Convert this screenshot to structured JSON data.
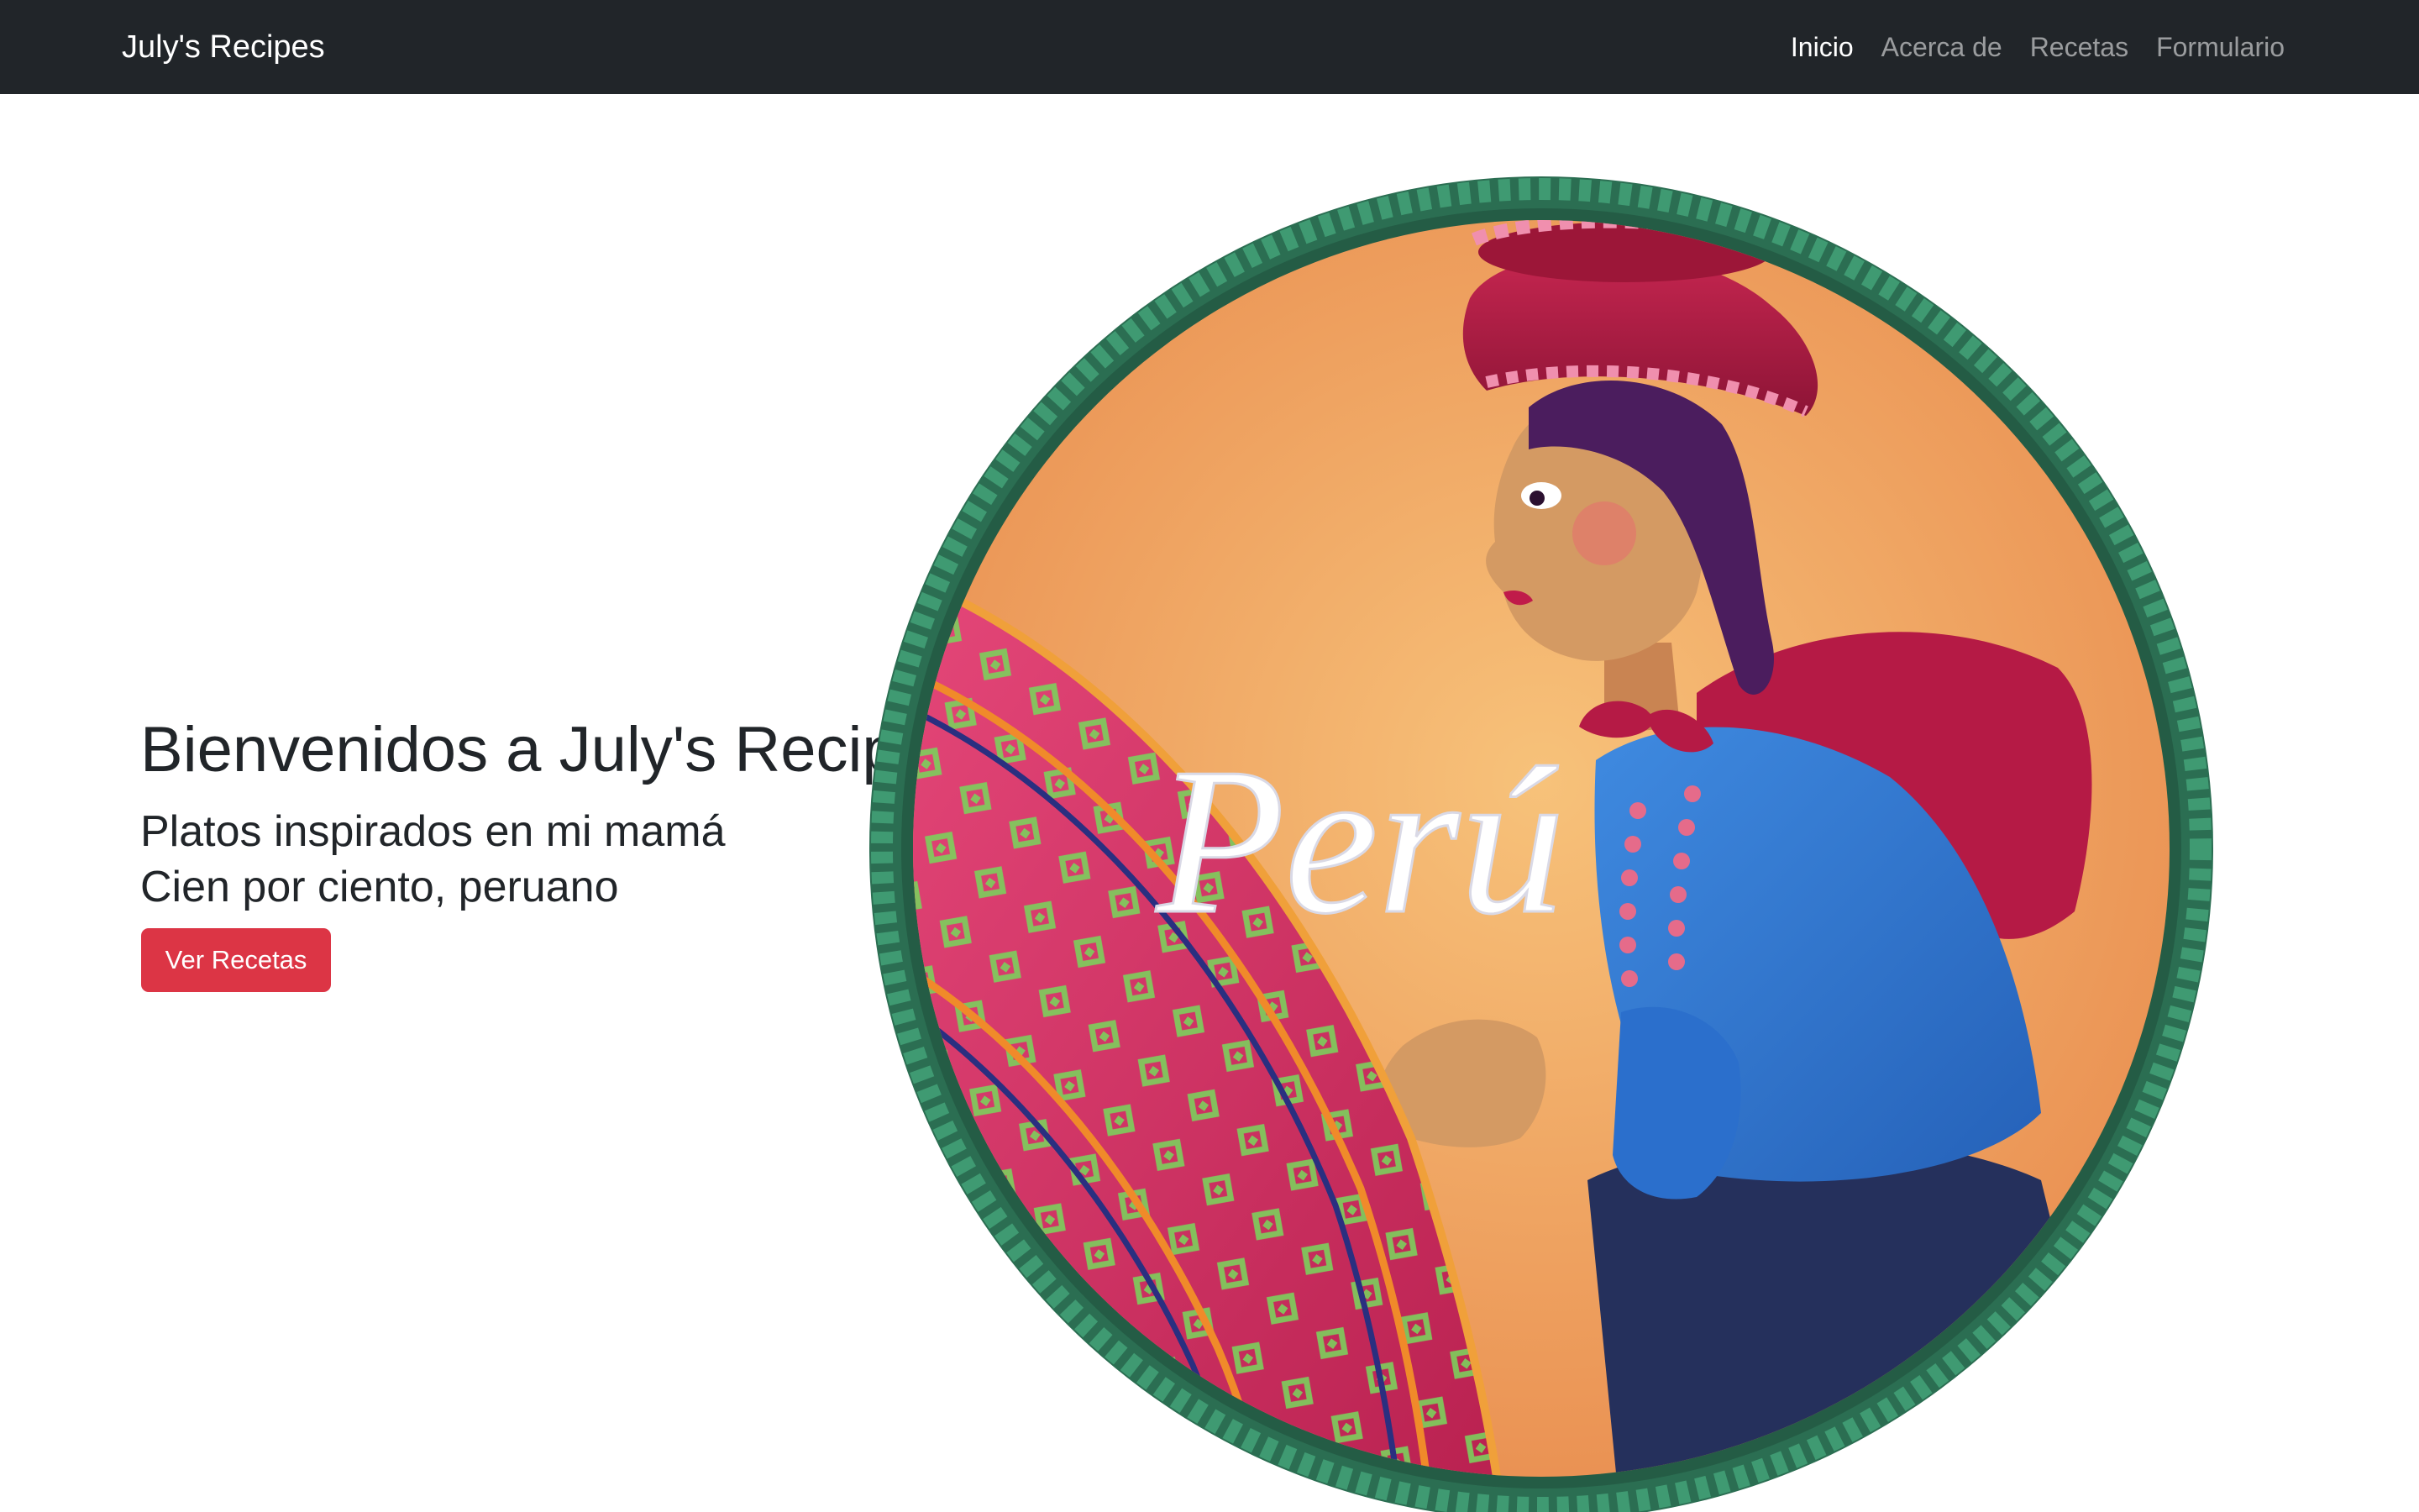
{
  "navbar": {
    "brand": "July's Recipes",
    "links": [
      {
        "label": "Inicio",
        "active": true
      },
      {
        "label": "Acerca de",
        "active": false
      },
      {
        "label": "Recetas",
        "active": false
      },
      {
        "label": "Formulario",
        "active": false
      }
    ]
  },
  "hero": {
    "title": "Bienvenidos a July's Recipes",
    "subtitle_line1": "Platos inspirados en mi mamá",
    "subtitle_line2": "Cien por ciento, peruano",
    "button_label": "Ver Recetas"
  },
  "illustration": {
    "script_text": "Perú"
  },
  "colors": {
    "navbar_bg": "#212529",
    "button_bg": "#dc3545",
    "frame_green": "#2f7a5c",
    "sky_orange": "#ee9a52",
    "textile_pink": "#d43468",
    "hat_red": "#b3183f",
    "shirt_blue": "#2f74cf",
    "skirt_navy": "#25305c"
  }
}
